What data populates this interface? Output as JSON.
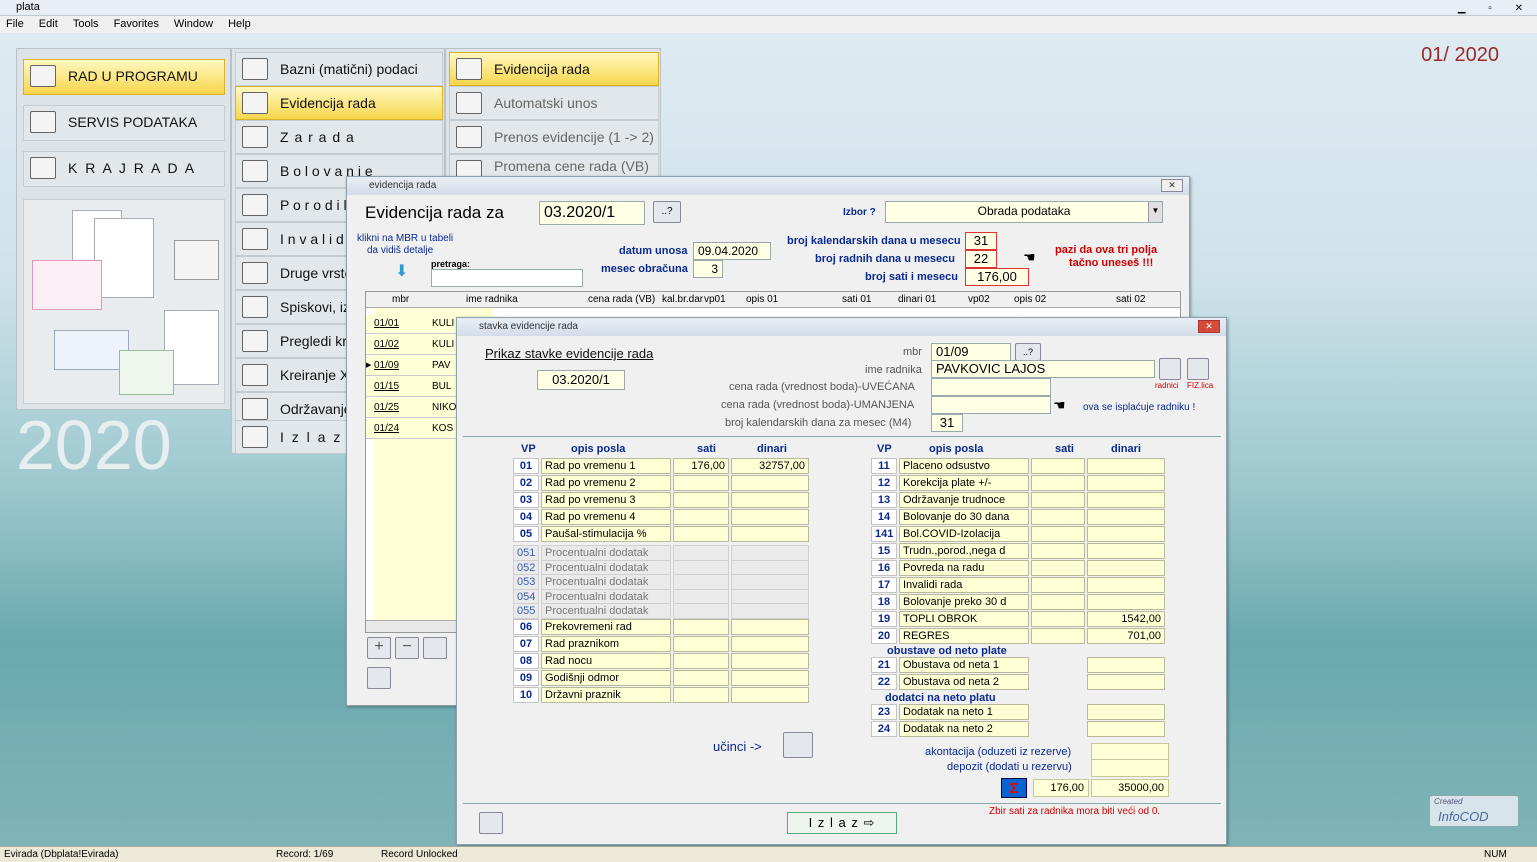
{
  "app": {
    "title": "plata",
    "period": "01/ 2020",
    "year": "2020"
  },
  "menubar": [
    "File",
    "Edit",
    "Tools",
    "Favorites",
    "Window",
    "Help"
  ],
  "main_menu": [
    "RAD  U  PROGRAMU",
    "SERVIS PODATAKA",
    "K R A J   R A D A"
  ],
  "sub_menu": [
    "Bazni (matični) podaci",
    "Evidencija rada",
    "Z a r a d a",
    "B o l o v a n j e",
    "P o r o d i l",
    "I n v a l i d",
    "Druge vrste",
    "Spiskovi, iz",
    "Pregledi kre",
    "Kreiranje XM",
    "Održavanje",
    "I z l a z"
  ],
  "sub_menu2": [
    "Evidencija rada",
    "Automatski unos",
    "Prenos evidencije (1 -> 2)",
    "Promena cene rada (VB)"
  ],
  "ev_window": {
    "title": "evidencija rada",
    "heading": "Evidencija rada za",
    "period": "03.2020/1",
    "help_btn": "..?",
    "izbor_label": "Izbor ?",
    "izbor_value": "Obrada podataka",
    "hint1": "klikni na MBR u tabeli",
    "hint2": "da vidiš detalje",
    "pretraga": "pretraga:",
    "datum_unosa_label": "datum unosa",
    "datum_unosa": "09.04.2020",
    "mesec_label": "mesec obračuna",
    "mesec": "3",
    "kal_label": "broj kalendarskih dana u mesecu",
    "kal": "31",
    "rad_label": "broj  radnih dana u mesecu",
    "rad": "22",
    "sati_label": "broj sati i mesecu",
    "sati": "176,00",
    "warning1": "pazi da ova tri polja",
    "warning2": "tačno uneseš !!!",
    "columns": [
      "mbr",
      "ime radnika",
      "cena rada (VB)",
      "kal.br.dar",
      "vp01",
      "opis 01",
      "sati 01",
      "dinari 01",
      "vp02",
      "opis 02",
      "sati 02"
    ],
    "rows": [
      {
        "mbr": "01/01",
        "ime": "KULI"
      },
      {
        "mbr": "01/02",
        "ime": "KULI"
      },
      {
        "mbr": "01/09",
        "ime": "PAV"
      },
      {
        "mbr": "01/15",
        "ime": "BUL"
      },
      {
        "mbr": "01/25",
        "ime": "NIKO"
      },
      {
        "mbr": "01/24",
        "ime": "KOS"
      }
    ]
  },
  "st_window": {
    "title": "stavka evidencije rada",
    "heading": "Prikaz stavke evidencije rada",
    "period": "03.2020/1",
    "mbr_label": "mbr",
    "mbr": "01/09",
    "mbr_btn": "..?",
    "ime_label": "ime radnika",
    "ime": "PAVKOVIC LAJOS",
    "uvecana_label": "cena rada (vrednost boda)-UVEĆANA",
    "umanjena_label": "cena rada (vrednost boda)-UMANJENA",
    "umanjena_note": "ova se isplaćuje radniku !",
    "kal_label": "broj kalendarskih dana za mesec (M4)",
    "kal": "31",
    "radnici_label": "radnici",
    "fiz_label": "FIZ.lica",
    "col_vp": "VP",
    "col_opis": "opis posla",
    "col_sati": "sati",
    "col_dinari": "dinari",
    "left": [
      {
        "vp": "01",
        "opis": "Rad po vremenu 1",
        "sati": "176,00",
        "dinari": "32757,00"
      },
      {
        "vp": "02",
        "opis": "Rad po vremenu 2",
        "sati": "",
        "dinari": ""
      },
      {
        "vp": "03",
        "opis": "Rad po vremenu 3",
        "sati": "",
        "dinari": ""
      },
      {
        "vp": "04",
        "opis": "Rad po vremenu 4",
        "sati": "",
        "dinari": ""
      },
      {
        "vp": "05",
        "opis": "Paušal-stimulacija %",
        "sati": "",
        "dinari": ""
      }
    ],
    "faint": [
      {
        "vp": "051",
        "opis": "Procentualni dodatak"
      },
      {
        "vp": "052",
        "opis": "Procentualni dodatak"
      },
      {
        "vp": "053",
        "opis": "Procentualni dodatak"
      },
      {
        "vp": "054",
        "opis": "Procentualni dodatak"
      },
      {
        "vp": "055",
        "opis": "Procentualni dodatak"
      }
    ],
    "left2": [
      {
        "vp": "06",
        "opis": "Prekovremeni rad"
      },
      {
        "vp": "07",
        "opis": "Rad praznikom"
      },
      {
        "vp": "08",
        "opis": "Rad nocu"
      },
      {
        "vp": "09",
        "opis": "Godišnji odmor"
      },
      {
        "vp": "10",
        "opis": "Državni praznik"
      }
    ],
    "right": [
      {
        "vp": "11",
        "opis": "Placeno odsustvo",
        "sati": "",
        "dinari": ""
      },
      {
        "vp": "12",
        "opis": "Korekcija plate +/-",
        "sati": "",
        "dinari": ""
      },
      {
        "vp": "13",
        "opis": "Održavanje trudnoce",
        "sati": "",
        "dinari": ""
      },
      {
        "vp": "14",
        "opis": "Bolovanje do 30 dana",
        "sati": "",
        "dinari": ""
      },
      {
        "vp": "141",
        "opis": "Bol.COVID-Izolacija",
        "sati": "",
        "dinari": ""
      },
      {
        "vp": "15",
        "opis": "Trudn.,porod.,nega d",
        "sati": "",
        "dinari": ""
      },
      {
        "vp": "16",
        "opis": "Povreda na radu",
        "sati": "",
        "dinari": ""
      },
      {
        "vp": "17",
        "opis": "Invalidi rada",
        "sati": "",
        "dinari": ""
      },
      {
        "vp": "18",
        "opis": "Bolovanje preko 30 d",
        "sati": "",
        "dinari": ""
      },
      {
        "vp": "19",
        "opis": "TOPLI OBROK",
        "sati": "",
        "dinari": "1542,00"
      },
      {
        "vp": "20",
        "opis": "REGRES",
        "sati": "",
        "dinari": "701,00"
      }
    ],
    "obustave_head": "obustave od neto plate",
    "obustave": [
      {
        "vp": "21",
        "opis": "Obustava od neta 1"
      },
      {
        "vp": "22",
        "opis": "Obustava od neta 2"
      }
    ],
    "dodaci_head": "dodatci na neto platu",
    "dodaci": [
      {
        "vp": "23",
        "opis": "Dodatak na neto 1"
      },
      {
        "vp": "24",
        "opis": "Dodatak na neto 2"
      }
    ],
    "akontacija_label": "akontacija (oduzeti iz rezerve)",
    "depozit_label": "depozit (dodati u rezervu)",
    "total_sati": "176,00",
    "total_dinari": "35000,00",
    "ucinci": "učinci ->",
    "izlaz": "I z l a z",
    "warn": "Zbir sati za radnika mora biti veći od 0."
  },
  "logo": {
    "line1": "Created",
    "line2": "InfoCOD"
  },
  "status": {
    "left": "Evirada (Dbplata!Evirada)",
    "record": "Record: 1/69",
    "lock": "Record Unlocked",
    "num": "NUM"
  }
}
